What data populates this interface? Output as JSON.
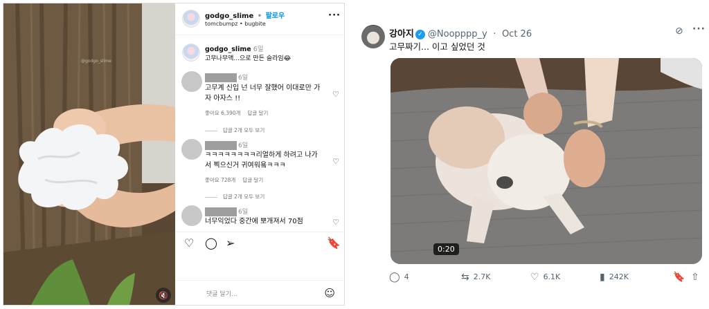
{
  "instagram": {
    "header": {
      "username": "godgo_slime",
      "separator": "•",
      "follow_label": "팔로우",
      "audio_line": "tomcbumpz • bugbite",
      "more_label": "···"
    },
    "photo": {
      "watermark": "@godgo_slime"
    },
    "caption": {
      "username": "godgo_slime",
      "time": "6일",
      "text": "고무나무액...으로 만든 슬라임😂"
    },
    "comments": [
      {
        "time": "6일",
        "text": "고무계 신입 넌 너무 잘했어 이대로만 가자 아자스 !!",
        "likes": "좋아요 6,390개",
        "reply_label": "답글 달기",
        "view_replies": "답글 2개 모두 보기"
      },
      {
        "time": "6일",
        "text": "ㅋㅋㅋㅋㅋㅋㅋㅋ리얼하게 하려고 나가서 찍으신거 귀여워욬ㅋㅋㅋ",
        "likes": "좋아요 728개",
        "reply_label": "답글 달기",
        "view_replies": "답글 2개 모두 보기"
      },
      {
        "time": "6일",
        "text": "너무익었다 중간에 뽀개져서 70점"
      }
    ],
    "add_comment_placeholder": "댓글 달기...",
    "icons": [
      "heart-icon",
      "comment-icon",
      "share-icon",
      "bookmark-icon",
      "emoji-icon",
      "mute-icon"
    ]
  },
  "tweet": {
    "display_name": "강아지",
    "verified_mark": "✓",
    "handle": "@Noopppp_y",
    "separator": "·",
    "date": "Oct 26",
    "more_label": "···",
    "text": "고무짜기... 이고 싶었던 것",
    "video_duration": "0:20",
    "stats": {
      "replies": "4",
      "reposts": "2.7K",
      "likes": "6.1K",
      "views": "242K"
    },
    "colors": {
      "verified": "#1d9bf0",
      "muted_text": "#536471"
    }
  }
}
